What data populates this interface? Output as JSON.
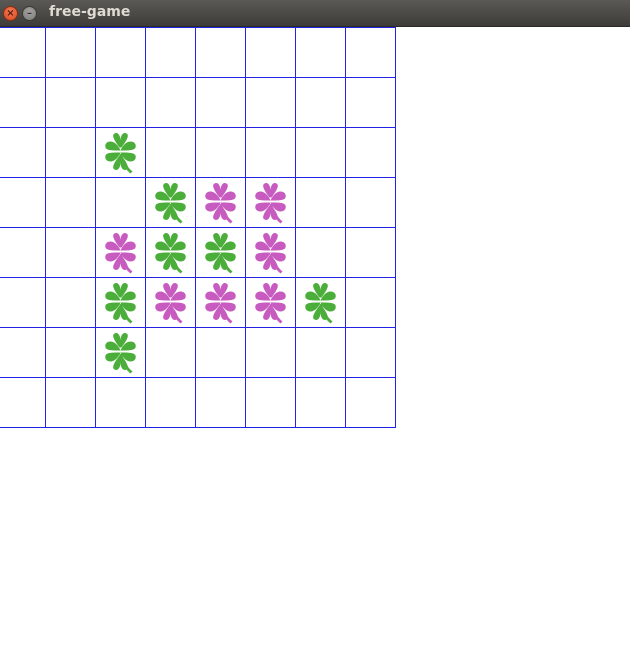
{
  "window": {
    "title": "free-game",
    "close_symbol": "×",
    "minimize_symbol": "–"
  },
  "board": {
    "rows": 8,
    "cols": 8,
    "grid_color": "#2323e6",
    "piece_colors": {
      "green": "#4cae3a",
      "pink": "#c75bbf"
    },
    "pieces": [
      {
        "row": 2,
        "col": 2,
        "color": "green",
        "icon": "four-leaf-clover"
      },
      {
        "row": 3,
        "col": 3,
        "color": "green",
        "icon": "four-leaf-clover"
      },
      {
        "row": 3,
        "col": 4,
        "color": "pink",
        "icon": "four-leaf-clover"
      },
      {
        "row": 3,
        "col": 5,
        "color": "pink",
        "icon": "four-leaf-clover"
      },
      {
        "row": 4,
        "col": 2,
        "color": "pink",
        "icon": "four-leaf-clover"
      },
      {
        "row": 4,
        "col": 3,
        "color": "green",
        "icon": "four-leaf-clover"
      },
      {
        "row": 4,
        "col": 4,
        "color": "green",
        "icon": "four-leaf-clover"
      },
      {
        "row": 4,
        "col": 5,
        "color": "pink",
        "icon": "four-leaf-clover"
      },
      {
        "row": 5,
        "col": 2,
        "color": "green",
        "icon": "four-leaf-clover"
      },
      {
        "row": 5,
        "col": 3,
        "color": "pink",
        "icon": "four-leaf-clover"
      },
      {
        "row": 5,
        "col": 4,
        "color": "pink",
        "icon": "four-leaf-clover"
      },
      {
        "row": 5,
        "col": 5,
        "color": "pink",
        "icon": "four-leaf-clover"
      },
      {
        "row": 5,
        "col": 6,
        "color": "green",
        "icon": "four-leaf-clover"
      },
      {
        "row": 6,
        "col": 2,
        "color": "green",
        "icon": "four-leaf-clover"
      }
    ]
  }
}
